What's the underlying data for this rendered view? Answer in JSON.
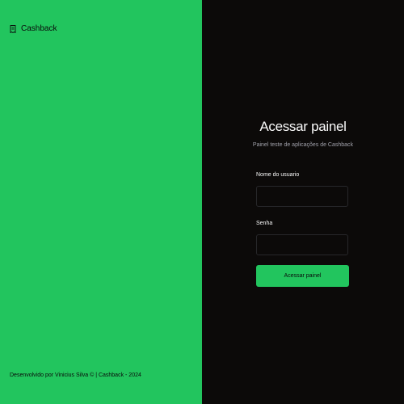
{
  "brand": {
    "name": "Cashback",
    "icon": "receipt-icon"
  },
  "footer": {
    "text": "Desenvolvido por Vinicius Silva © | Cashback - 2024"
  },
  "login_form": {
    "title": "Acessar painel",
    "subtitle": "Painel teste de aplicações de Cashback",
    "username_label": "Nome do usuario",
    "username_value": "",
    "password_label": "Senha",
    "password_value": "",
    "submit_label": "Acessar painel"
  },
  "colors": {
    "accent": "#22c55e",
    "dark_background": "#0c0a09",
    "input_border": "#27272a"
  }
}
